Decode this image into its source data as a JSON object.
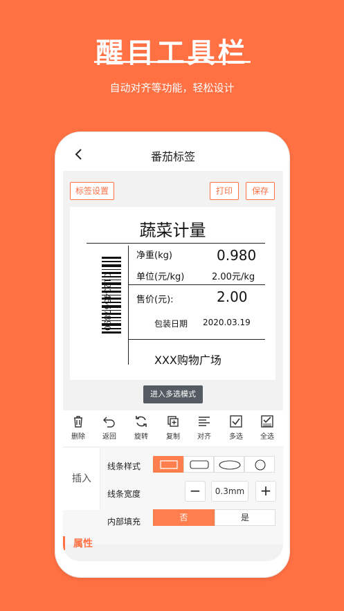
{
  "promo": {
    "title": "醒目工具栏",
    "subtitle": "自动对齐等功能，轻松设计"
  },
  "app": {
    "title": "番茄标签",
    "buttons": {
      "label_settings": "标签设置",
      "print": "打印",
      "save": "保存"
    },
    "multi_select_mode": "进入多选模式"
  },
  "label": {
    "title": "蔬菜计量",
    "barcode_number": "01234567890",
    "rows": {
      "net_weight_label": "净重(kg)",
      "net_weight_value": "0.980",
      "unit_label": "单位(元/kg)",
      "unit_value": "2.00元/kg",
      "price_label": "售价(元):",
      "price_value": "2.00",
      "pack_date_label": "包装日期",
      "pack_date_value": "2020.03.19",
      "store": "XXX购物广场"
    }
  },
  "tools": [
    {
      "label": "删除",
      "icon": "trash-icon"
    },
    {
      "label": "返回",
      "icon": "undo-icon"
    },
    {
      "label": "旋转",
      "icon": "rotate-icon"
    },
    {
      "label": "复制",
      "icon": "copy-icon"
    },
    {
      "label": "对齐",
      "icon": "align-icon"
    },
    {
      "label": "多选",
      "icon": "checkbox-icon"
    },
    {
      "label": "全选",
      "icon": "select-all-icon"
    }
  ],
  "properties": {
    "insert_tab": "插入",
    "line_style_label": "线条样式",
    "line_width_label": "线条宽度",
    "line_width_value": "0.3mm",
    "minus": "−",
    "plus": "+",
    "fill_label": "内部填充",
    "fill_no": "否",
    "fill_yes": "是",
    "fill_selected": "否",
    "attr_tab": "属性"
  },
  "colors": {
    "accent": "#ff7043",
    "background": "#ff7043",
    "dark_button": "#555b63"
  }
}
